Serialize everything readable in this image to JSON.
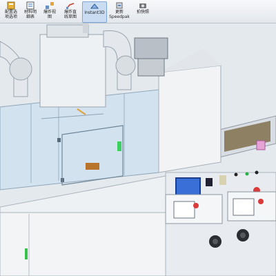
{
  "toolbar": {
    "buttons": [
      {
        "label": "配置选\n项选项",
        "icon": "options-icon"
      },
      {
        "label": "材料明\n细表",
        "icon": "bom-icon"
      },
      {
        "label": "爆炸视\n图",
        "icon": "explode-view-icon"
      },
      {
        "label": "爆炸直\n线草图",
        "icon": "explode-line-sketch-icon"
      },
      {
        "label": "Instant3D",
        "icon": "instant3d-icon"
      },
      {
        "label": "更新\nSpeedpak",
        "icon": "speedpak-icon"
      },
      {
        "label": "拍快照",
        "icon": "snapshot-icon"
      }
    ]
  },
  "colors": {
    "machine_body": "#eef1f4",
    "glass": "#cfe1ee",
    "screen": "#3a6fd8",
    "button_red": "#d93a3a",
    "duct": "#e6e9ec"
  }
}
